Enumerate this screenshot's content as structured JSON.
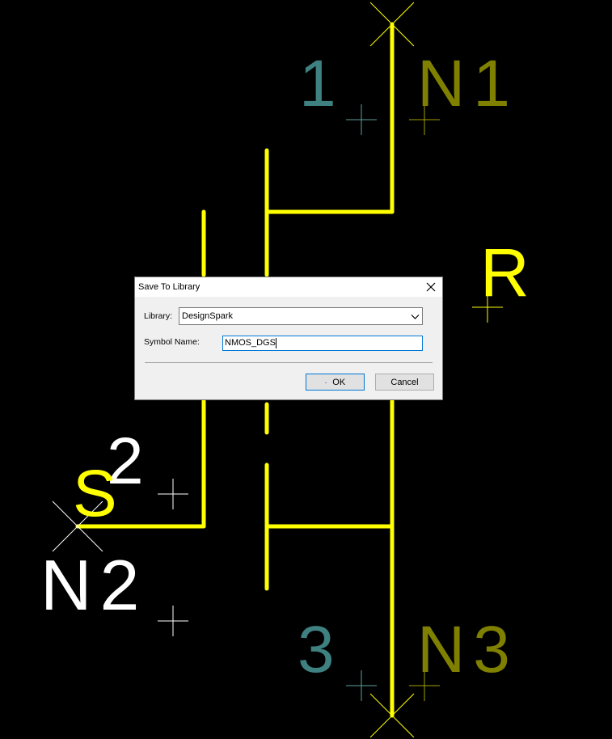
{
  "schematic": {
    "pin_numbers": [
      "1",
      "2",
      "3"
    ],
    "net_labels": [
      "N1",
      "N2",
      "N3"
    ],
    "attributes": [
      "R",
      "S"
    ],
    "colors": {
      "background": "#000000",
      "symbol_lines": "#ffff00",
      "pin_number_text": "#3f8080",
      "net_label_text": "#808000",
      "white_text": "#ffffff",
      "crosshair": "#ffffff"
    }
  },
  "dialog": {
    "title": "Save To Library",
    "library_label": "Library:",
    "library_value": "DesignSpark",
    "symbol_name_label": "Symbol Name:",
    "symbol_name_value": "NMOS_DGS",
    "ok_label": "OK",
    "cancel_label": "Cancel",
    "close_icon": "close-icon",
    "dropdown_icon": "chevron-down-icon"
  }
}
